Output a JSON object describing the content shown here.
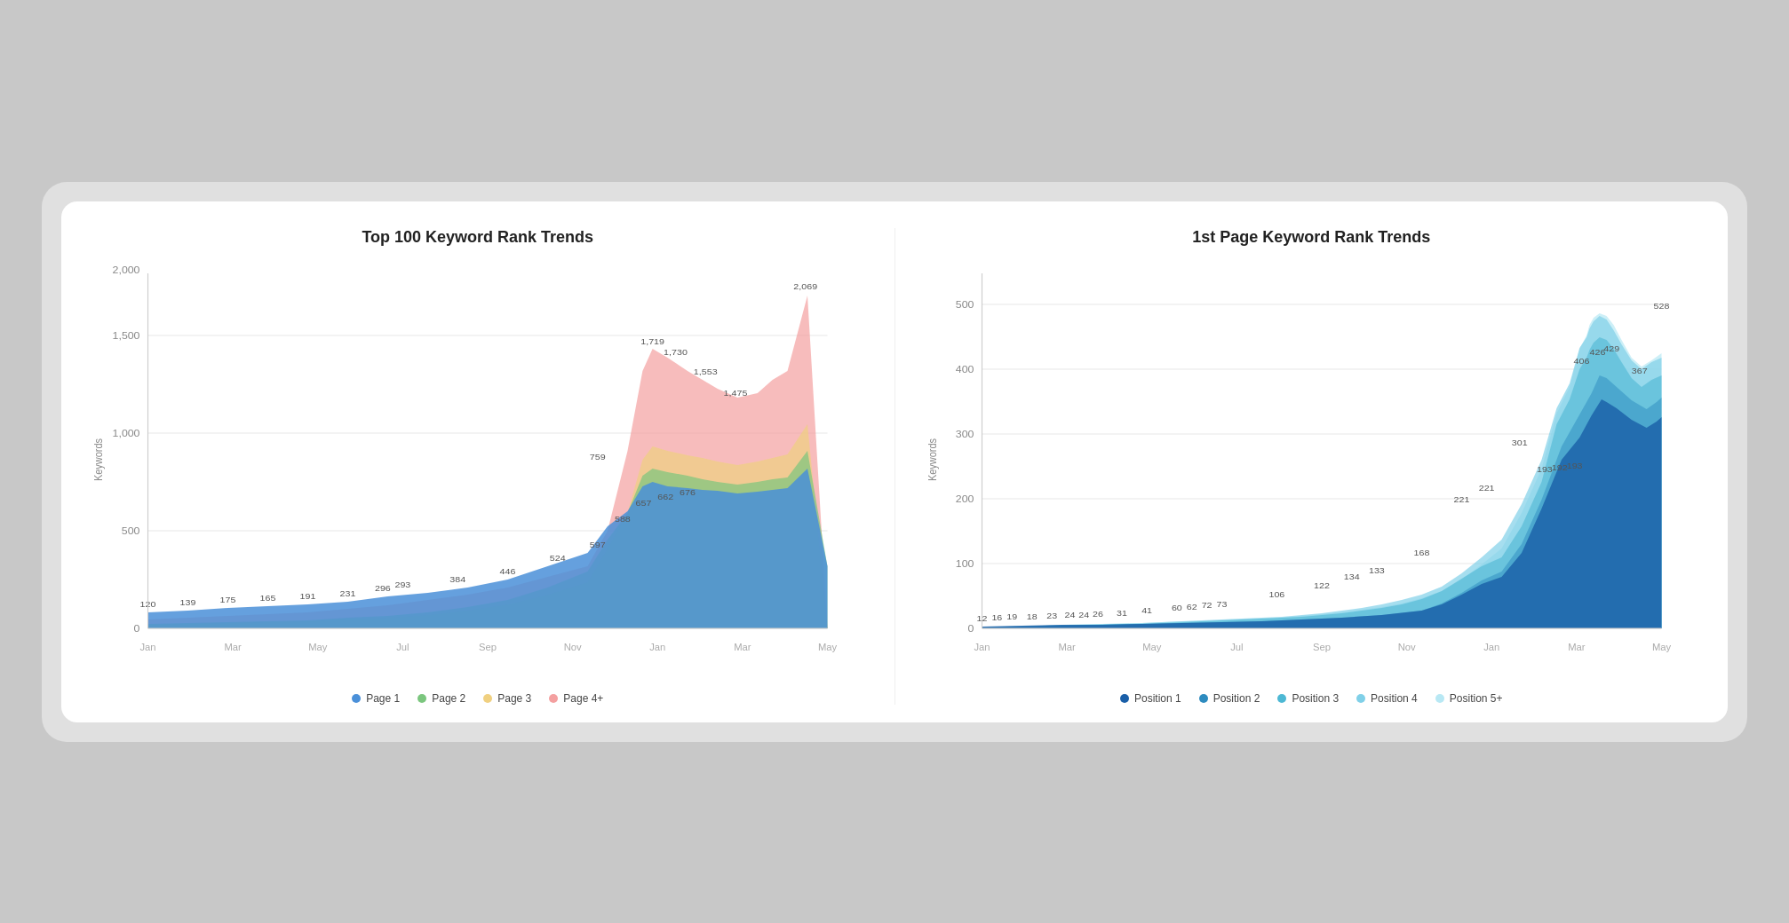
{
  "page": {
    "background": "#c8c8c8"
  },
  "chart1": {
    "title": "Top 100 Keyword Rank Trends",
    "y_axis_label": "Keywords",
    "y_ticks": [
      0,
      500,
      1000,
      1500,
      2000
    ],
    "legend": [
      {
        "label": "Page 1",
        "color": "#4a90d9"
      },
      {
        "label": "Page 2",
        "color": "#7bc67e"
      },
      {
        "label": "Page 3",
        "color": "#f0d080"
      },
      {
        "label": "Page 4+",
        "color": "#f4a0a0"
      }
    ],
    "data_labels": {
      "p1": [
        "120",
        "139",
        "175",
        "165",
        "191",
        "231",
        "296",
        "293",
        "384",
        "446",
        "524",
        "597",
        "588",
        "657",
        "662",
        "676"
      ],
      "p2_top": [
        "",
        "",
        "",
        "",
        "",
        "",
        "",
        "",
        "",
        "",
        "759",
        "",
        "",
        "",
        "",
        ""
      ],
      "p4_peak": [
        "",
        "",
        "",
        "",
        "",
        "",
        "",
        "",
        "",
        "",
        "",
        "",
        "1,719",
        "1,730",
        "1,553",
        "1,475",
        "2,069"
      ]
    }
  },
  "chart2": {
    "title": "1st Page Keyword Rank Trends",
    "y_axis_label": "Keywords",
    "y_ticks": [
      0,
      100,
      200,
      300,
      400,
      500
    ],
    "legend": [
      {
        "label": "Position 1",
        "color": "#1a5fa8"
      },
      {
        "label": "Position 2",
        "color": "#2d8bbf"
      },
      {
        "label": "Position 3",
        "color": "#4db8d4"
      },
      {
        "label": "Position 4",
        "color": "#80d0e8"
      },
      {
        "label": "Position 5+",
        "color": "#b8e8f4"
      }
    ],
    "data_labels": {
      "pos_labels": [
        "12",
        "16",
        "19",
        "18",
        "23",
        "24",
        "24",
        "26",
        "31",
        "41",
        "60",
        "62",
        "72",
        "73",
        "106",
        "122",
        "134",
        "133",
        "168",
        "221",
        "221",
        "301",
        "193",
        "192",
        "193",
        "406",
        "426",
        "429",
        "367",
        "528"
      ]
    }
  }
}
